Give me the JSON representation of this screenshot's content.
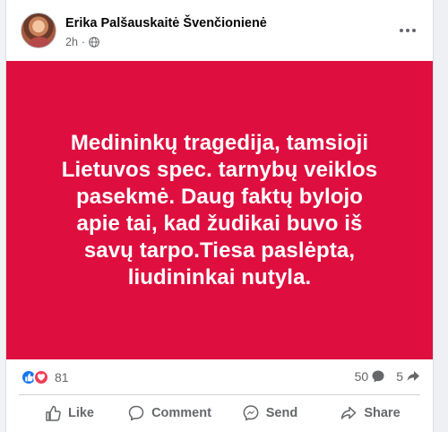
{
  "post": {
    "author": "Erika Palšauskaitė Švenčionienė",
    "time": "2h",
    "text": "Medininkų tragedija, tamsioji\nLietuvos spec. tarnybų veiklos\npasekmė. Daug faktų bylojo\napie tai, kad žudikai buvo iš\nsavų tarpo.Tiesa paslėpta,\nliudininkai nutyla.",
    "background_color": "#de0f3f",
    "reactions_count": "81",
    "comments_count": "50",
    "shares_count": "5"
  },
  "actions": {
    "like": "Like",
    "comment": "Comment",
    "send": "Send",
    "share": "Share"
  },
  "icons": {
    "reactions": [
      "like-reaction-icon",
      "love-reaction-icon"
    ],
    "privacy": "globe-icon",
    "menu": "more-options-icon"
  }
}
